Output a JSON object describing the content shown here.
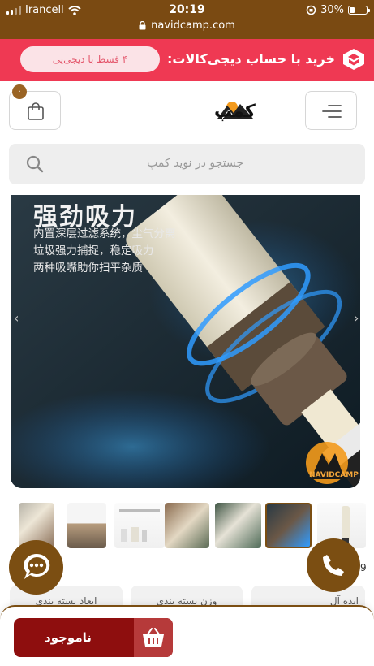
{
  "status_bar": {
    "carrier": "Irancell",
    "time": "20:19",
    "battery": "30%",
    "battery_level": 0.3,
    "url": "navidcamp.com"
  },
  "promo": {
    "text": "خرید با حساب دیجی‌کالات:",
    "pill": "۴ قسط با دیجی‌پی",
    "color": "#ef3953"
  },
  "header": {
    "cart_count": "۰",
    "logo_text": "نویدکمپ"
  },
  "search": {
    "placeholder": "جستجو در نوید کمپ"
  },
  "gallery": {
    "title": "强劲吸力",
    "lines": [
      "内置深层过滤系统，尘气分离",
      "垃圾强力捕捉，稳定吸力",
      "两种吸嘴助你扫平杂质"
    ],
    "brand": "NAVIDCAMP",
    "thumb_count": 7
  },
  "specs": {
    "items": [
      "ابعاد بسته بندی",
      "وزن بسته بندی",
      "ایده آل"
    ],
    "overflow_char": "9"
  },
  "bottom": {
    "unavailable": "ناموجود"
  },
  "colors": {
    "brand": "#7b4e12",
    "unavailable": "#8e0e0e"
  }
}
